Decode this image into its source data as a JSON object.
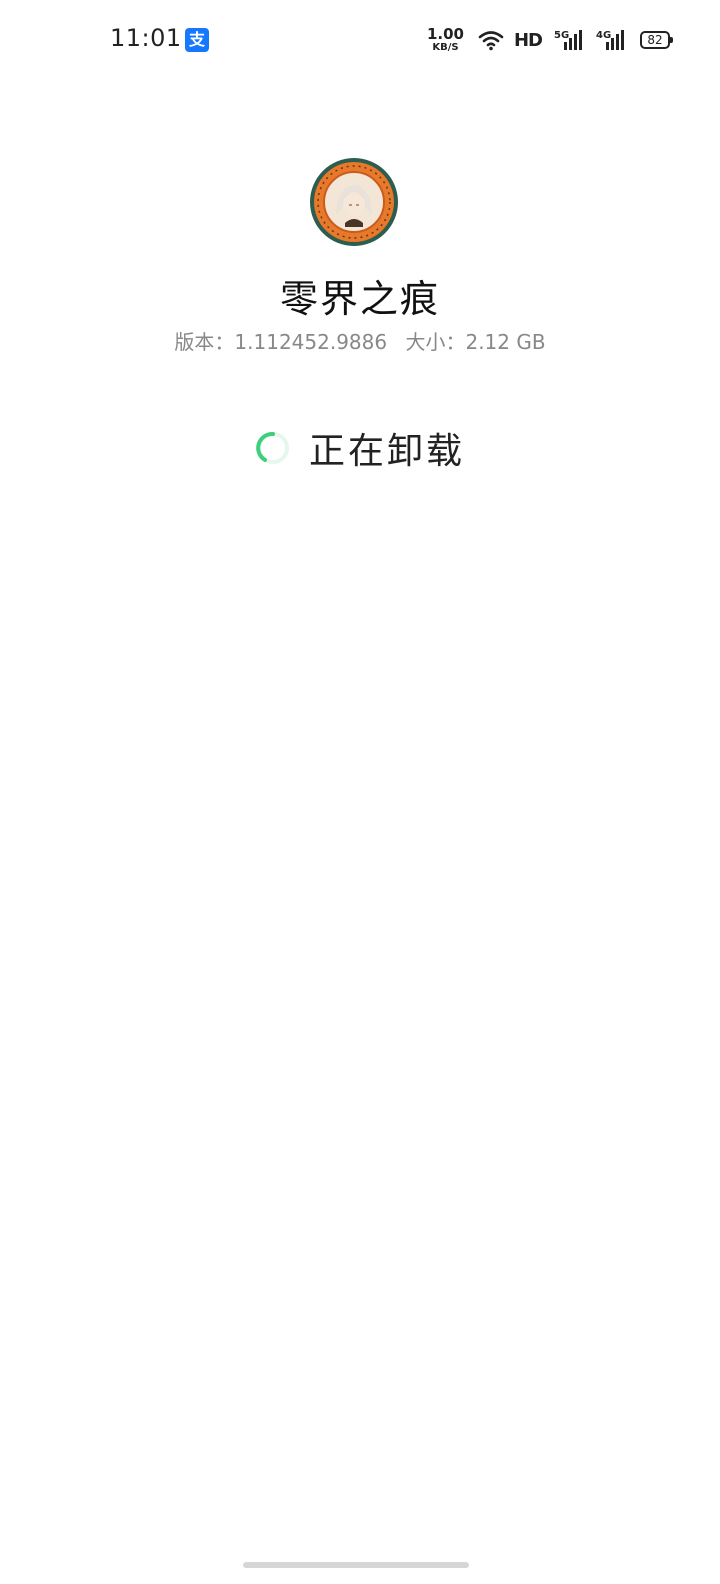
{
  "status_bar": {
    "time": "11:01",
    "notification_icon": "alipay-icon",
    "notification_glyph": "支",
    "net_speed_value": "1.00",
    "net_speed_unit": "KB/S",
    "wifi_icon": "wifi-icon",
    "hd_label": "HD",
    "signal_1_label": "5G",
    "signal_2_label": "4G",
    "battery_level": "82"
  },
  "app": {
    "name": "零界之痕",
    "version_label": "版本：1.112452.9886",
    "size_label": "大小：2.12 GB",
    "icon": "app-icon"
  },
  "uninstall": {
    "status_text": "正在卸载",
    "spinner_color": "#3ecf7a"
  },
  "colors": {
    "background": "#ffffff",
    "accent": "#3ecf7a",
    "meta_text": "#888888",
    "alipay_blue": "#1677ff"
  }
}
